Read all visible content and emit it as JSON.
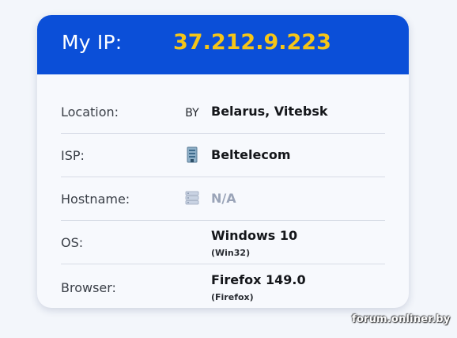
{
  "header": {
    "label": "My IP:",
    "ip": "37.212.9.223"
  },
  "rows": [
    {
      "label": "Location:",
      "icon_text": "BY",
      "value": "Belarus, Vitebsk"
    },
    {
      "label": "ISP:",
      "icon": "building-icon",
      "value": "Beltelecom"
    },
    {
      "label": "Hostname:",
      "icon": "server-icon",
      "value": "N/A"
    },
    {
      "label": "OS:",
      "value": "Windows 10",
      "sub": "(Win32)"
    },
    {
      "label": "Browser:",
      "value": "Firefox 149.0",
      "sub": "(Firefox)"
    }
  ],
  "watermark": "forum.onliner.by",
  "colors": {
    "header_bg": "#0b4fd8",
    "ip_accent": "#f5c518",
    "na_text": "#9aa4b8"
  }
}
